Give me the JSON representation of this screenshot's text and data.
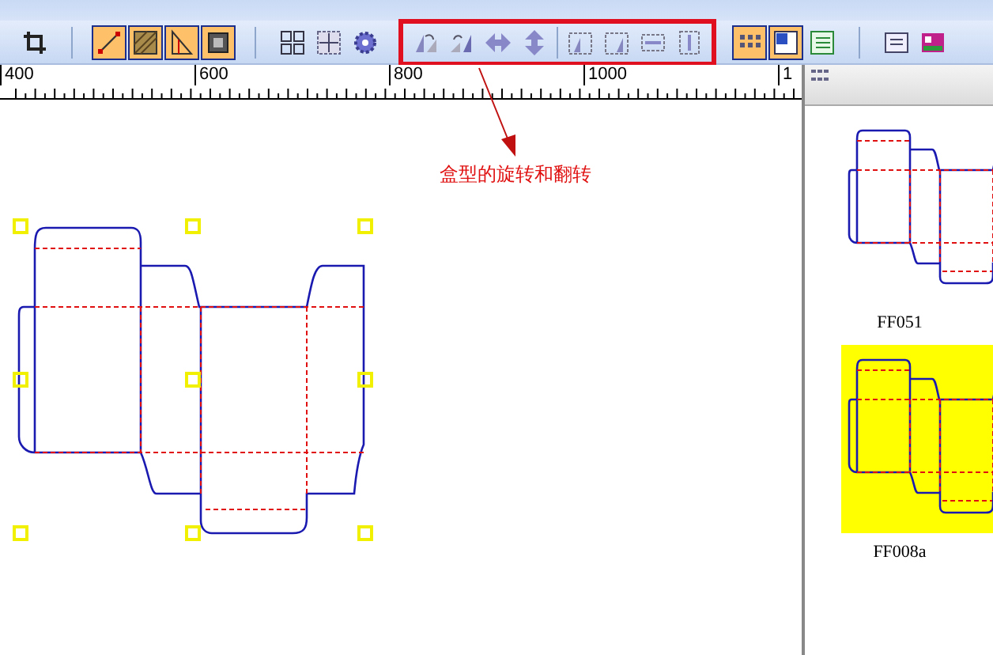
{
  "toolbar": {
    "groups": [
      {
        "highlighted": false,
        "sections": [
          [
            {
              "kind": "crop",
              "selected": false
            }
          ]
        ]
      },
      {
        "highlighted": false,
        "sections": [
          [
            {
              "kind": "line",
              "selected": true
            },
            {
              "kind": "hatch",
              "selected": true
            },
            {
              "kind": "triangle",
              "selected": true
            },
            {
              "kind": "frame",
              "selected": true
            }
          ]
        ]
      },
      {
        "highlighted": false,
        "sections": [
          [
            {
              "kind": "grid",
              "selected": false
            },
            {
              "kind": "expand",
              "selected": false
            },
            {
              "kind": "gear",
              "selected": false
            }
          ]
        ]
      },
      {
        "highlighted": true,
        "sections": [
          [
            {
              "kind": "rotate-left",
              "selected": false
            },
            {
              "kind": "rotate-right",
              "selected": false
            },
            {
              "kind": "flip-h",
              "selected": false
            },
            {
              "kind": "flip-v",
              "selected": false
            }
          ],
          [
            {
              "kind": "page-rotate-left",
              "selected": false
            },
            {
              "kind": "page-rotate-right",
              "selected": false
            },
            {
              "kind": "page-flip-h",
              "selected": false
            },
            {
              "kind": "page-flip-v",
              "selected": false
            }
          ]
        ]
      },
      {
        "highlighted": false,
        "sections": [
          [
            {
              "kind": "dots",
              "selected": true
            },
            {
              "kind": "window",
              "selected": true
            },
            {
              "kind": "list",
              "selected": false
            }
          ]
        ]
      },
      {
        "highlighted": false,
        "sections": [
          [
            {
              "kind": "form",
              "selected": false
            },
            {
              "kind": "palette",
              "selected": false
            }
          ]
        ]
      }
    ]
  },
  "ruler": {
    "labels": [
      "400",
      "600",
      "800",
      "1000",
      "1"
    ]
  },
  "annotation": {
    "label": "盒型的旋转和翻转"
  },
  "thumbnails": [
    {
      "caption": "FF051",
      "selected": false
    },
    {
      "caption": "FF008a",
      "selected": true
    }
  ]
}
